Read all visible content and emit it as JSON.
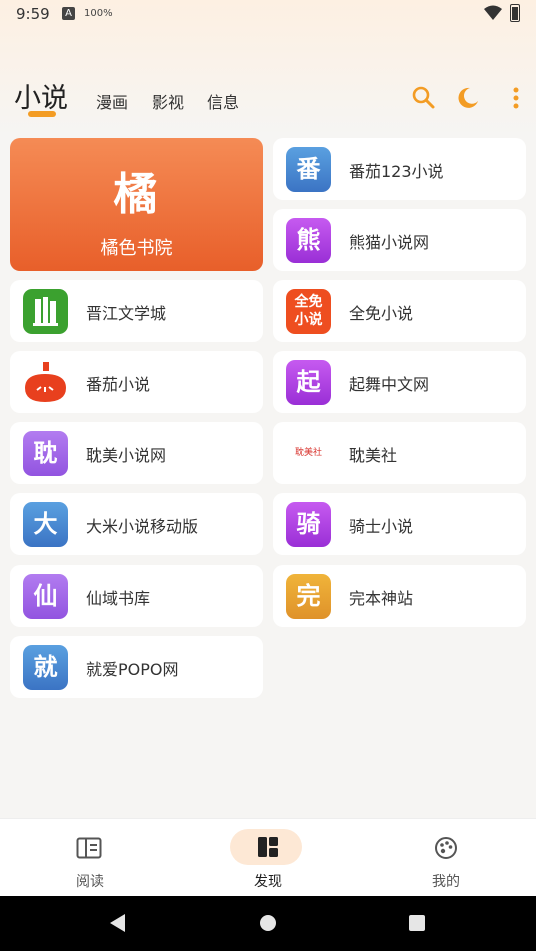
{
  "status": {
    "time": "9:59",
    "battery_text": "100%"
  },
  "tabs": {
    "active": "小说",
    "others": [
      "漫画",
      "影视",
      "信息"
    ]
  },
  "icons": {
    "search": "search-icon",
    "theme": "moon-icon",
    "more": "more-vert-icon"
  },
  "featured": {
    "glyph": "橘",
    "label": "橘色书院"
  },
  "sources": {
    "right_top": [
      {
        "icon_text": "番",
        "label": "番茄123小说",
        "color": "#4a89d3"
      },
      {
        "icon_text": "熊",
        "label": "熊猫小说网",
        "color": "#b53ee6"
      }
    ],
    "rows": [
      {
        "left": {
          "icon_text": "",
          "label": "晋江文学城",
          "color": "#3ba12f"
        },
        "right": {
          "icon_text": "全免小说",
          "label": "全免小说",
          "color": "#ee4e20"
        }
      },
      {
        "left": {
          "icon_text": "",
          "label": "番茄小说",
          "color": "#e8401e"
        },
        "right": {
          "icon_text": "起",
          "label": "起舞中文网",
          "color": "#b53ee6"
        }
      },
      {
        "left": {
          "icon_text": "耽",
          "label": "耽美小说网",
          "color": "#a364e6"
        },
        "right": {
          "icon_text": "耽美社",
          "label": "耽美社",
          "color": "#d8342e"
        }
      },
      {
        "left": {
          "icon_text": "大",
          "label": "大米小说移动版",
          "color": "#4a89d3"
        },
        "right": {
          "icon_text": "骑",
          "label": "骑士小说",
          "color": "#b53ee6"
        }
      },
      {
        "left": {
          "icon_text": "仙",
          "label": "仙域书库",
          "color": "#a364e6"
        },
        "right": {
          "icon_text": "完",
          "label": "完本神站",
          "color": "#e6a12a"
        }
      },
      {
        "left": {
          "icon_text": "就",
          "label": "就爱POPO网",
          "color": "#4a89d3"
        }
      }
    ]
  },
  "nav": {
    "items": [
      "阅读",
      "发现",
      "我的"
    ],
    "active_index": 1
  }
}
